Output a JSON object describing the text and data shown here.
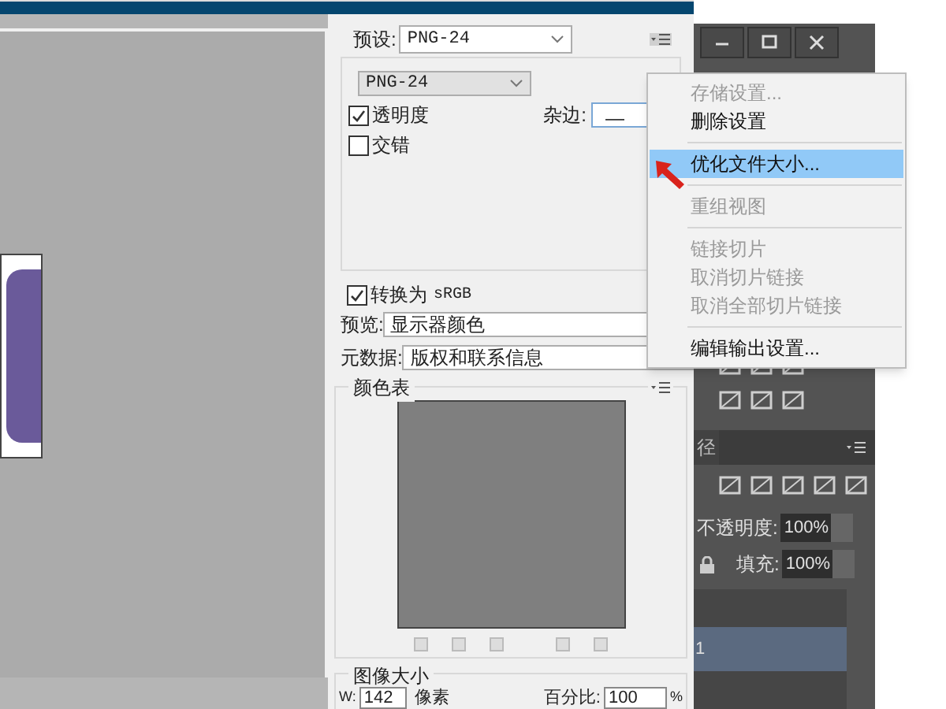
{
  "dialog": {
    "preset_label": "预设:",
    "preset": "PNG-24",
    "format": "PNG-24",
    "options": [
      {
        "label": "透明度",
        "checked": true
      },
      {
        "label": "交错",
        "checked": false
      }
    ],
    "matte_label": "杂边:",
    "matte": "—",
    "convert": {
      "label": "转换为",
      "profile": "sRGB",
      "checked": true
    },
    "preview_label": "预览:",
    "preview": "显示器颜色",
    "metadata_label": "元数据:",
    "metadata": "版权和联系信息",
    "color_table": {
      "title": "颜色表"
    },
    "image_size": {
      "title": "图像大小",
      "w_label": "W:",
      "w": "142",
      "w_unit": "像素",
      "percent_label": "百分比:",
      "percent": "100",
      "percent_unit": "%"
    }
  },
  "menu": {
    "groups": [
      [
        {
          "label": "存储设置...",
          "disabled": true,
          "selected": false
        },
        {
          "label": "删除设置",
          "disabled": false,
          "selected": false
        }
      ],
      [
        {
          "label": "优化文件大小...",
          "disabled": false,
          "selected": true
        }
      ],
      [
        {
          "label": "重组视图",
          "disabled": true,
          "selected": false
        }
      ],
      [
        {
          "label": "链接切片",
          "disabled": true,
          "selected": false
        },
        {
          "label": "取消切片链接",
          "disabled": true,
          "selected": false
        },
        {
          "label": "取消全部切片链接",
          "disabled": true,
          "selected": false
        }
      ],
      [
        {
          "label": "编辑输出设置...",
          "disabled": false,
          "selected": false
        }
      ]
    ]
  },
  "layers_panel": {
    "tab": "径",
    "opacity_label": "不透明度:",
    "opacity": "100%",
    "fill_label": "填充:",
    "fill": "100%",
    "layer": {
      "name": "1",
      "selected": true
    }
  }
}
